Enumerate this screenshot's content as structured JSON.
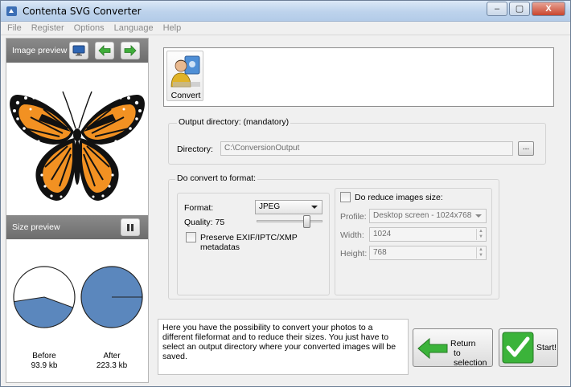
{
  "window": {
    "title": "Contenta SVG Converter"
  },
  "window_controls": {
    "minimize": "–",
    "maximize": "▢",
    "close": "X"
  },
  "menu": [
    "File",
    "Register",
    "Options",
    "Language",
    "Help"
  ],
  "image_preview": {
    "label": "Image preview"
  },
  "size_preview": {
    "label": "Size preview",
    "before_label": "Before",
    "before_size": "93.9 kb",
    "after_label": "After",
    "after_size": "223.3 kb"
  },
  "toolbar": {
    "convert_label": "Convert"
  },
  "output": {
    "group_title": "Output directory: (mandatory)",
    "directory_label": "Directory:",
    "directory_value": "C:\\ConversionOutput",
    "browse_label": "..."
  },
  "format": {
    "group_title": "Do convert to format:",
    "format_label": "Format:",
    "format_value": "JPEG",
    "quality_label": "Quality: 75",
    "quality_value": 75,
    "preserve_label": "Preserve EXIF/IPTC/XMP metadatas"
  },
  "reduce": {
    "checkbox_label": "Do reduce images size:",
    "profile_label": "Profile:",
    "profile_value": "Desktop screen - 1024x768",
    "width_label": "Width:",
    "width_value": "1024",
    "height_label": "Height:",
    "height_value": "768"
  },
  "info_text": "Here you have the possibility to convert your photos to a different fileformat and to reduce their sizes. You just have to select an output directory where your converted images will be saved.",
  "buttons": {
    "return_line1": "Return",
    "return_line2": "to selection",
    "start": "Start!"
  },
  "colors": {
    "pie_fill": "#5b87bd",
    "orange": "#f29122",
    "accent_green": "#3bb33a"
  }
}
